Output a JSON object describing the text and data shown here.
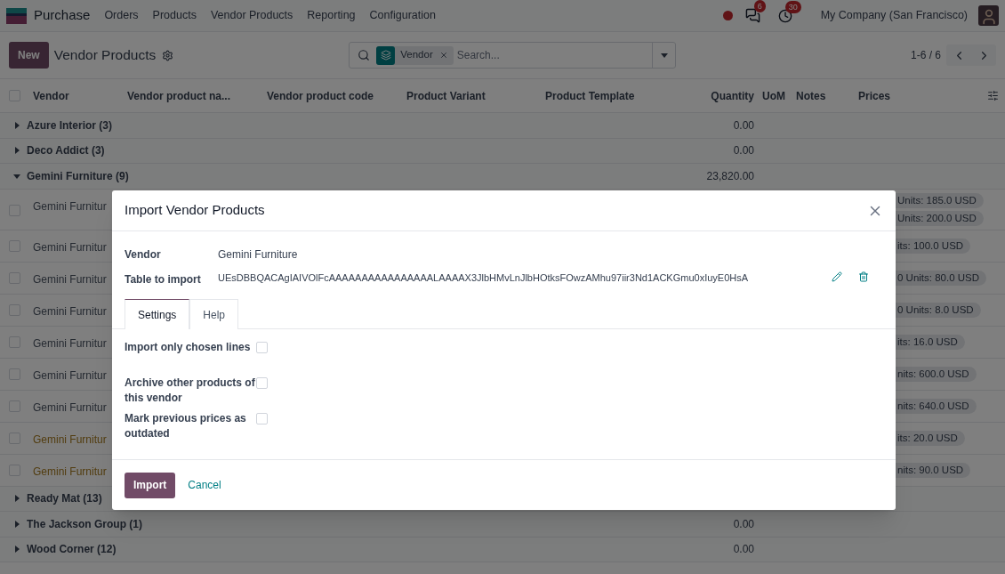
{
  "navbar": {
    "app": "Purchase",
    "menu": [
      "Orders",
      "Products",
      "Vendor Products",
      "Reporting",
      "Configuration"
    ],
    "messages_badge": "6",
    "activities_badge": "30",
    "company": "My Company (San Francisco)"
  },
  "control_panel": {
    "new_button": "New",
    "title": "Vendor Products",
    "facet": "Vendor",
    "search_placeholder": "Search...",
    "pager": "1-6 / 6"
  },
  "table": {
    "all_selected": false,
    "columns": [
      "Vendor",
      "Vendor product na...",
      "Vendor product code",
      "Product Variant",
      "Product Template",
      "Quantity",
      "UoM",
      "Notes",
      "Prices"
    ],
    "groups": [
      {
        "label": "Azure Interior (3)",
        "expanded": false,
        "quantity": "0.00"
      },
      {
        "label": "Deco Addict (3)",
        "expanded": false,
        "quantity": "0.00"
      },
      {
        "label": "Gemini Furniture (9)",
        "expanded": true,
        "quantity": "23,820.00",
        "rows": [
          {
            "name": "Gemini Furnitur",
            "selected": false,
            "highlighted": false,
            "prices": [
              "Units: 185.0 USD",
              "Units: 200.0 USD"
            ]
          },
          {
            "name": "Gemini Furnitur",
            "selected": false,
            "highlighted": false,
            "prices": [
              "its: 100.0 USD"
            ]
          },
          {
            "name": "Gemini Furnitur",
            "selected": false,
            "highlighted": false,
            "prices": [
              "0 Units: 80.0 USD"
            ]
          },
          {
            "name": "Gemini Furnitur",
            "selected": false,
            "highlighted": false,
            "prices": [
              "0 Units: 8.0 USD"
            ]
          },
          {
            "name": "Gemini Furnitur",
            "selected": false,
            "highlighted": false,
            "prices": [
              "its: 16.0 USD"
            ]
          },
          {
            "name": "Gemini Furnitur",
            "selected": false,
            "highlighted": false,
            "prices": [
              "nits: 600.0 USD"
            ]
          },
          {
            "name": "Gemini Furnitur",
            "selected": false,
            "highlighted": false,
            "prices": [
              "nits: 640.0 USD"
            ]
          },
          {
            "name": "Gemini Furnitur",
            "selected": false,
            "highlighted": true,
            "prices": [
              "its: 20.0 USD"
            ]
          },
          {
            "name": "Gemini Furnitur",
            "selected": false,
            "highlighted": true,
            "prices": [
              "nits: 90.0 USD"
            ]
          }
        ]
      },
      {
        "label": "Ready Mat (13)",
        "expanded": false
      },
      {
        "label": "The Jackson Group (1)",
        "expanded": false,
        "quantity": "0.00"
      },
      {
        "label": "Wood Corner (12)",
        "expanded": false,
        "quantity": "0.00"
      }
    ]
  },
  "dialog": {
    "title": "Import Vendor Products",
    "fields": [
      {
        "label": "Vendor",
        "value": "Gemini Furniture"
      },
      {
        "label": "Table to import",
        "value": "UEsDBBQACAgIAIVOlFcAAAAAAAAAAAAAAAALAAAAX3JlbHMvLnJlbHOtksFOwzAMhu97iir3Nd1ACKGmu0xIuyE0HsA"
      }
    ],
    "tabs": [
      {
        "label": "Settings",
        "selected": true
      },
      {
        "label": "Help",
        "selected": false
      }
    ],
    "options": [
      {
        "label": "Import only chosen lines",
        "checked": false
      },
      {
        "label": "Archive other products of this vendor",
        "checked": false
      },
      {
        "label": "Mark previous prices as outdated",
        "checked": false
      }
    ],
    "primary_button": "Import",
    "cancel_link": "Cancel"
  }
}
